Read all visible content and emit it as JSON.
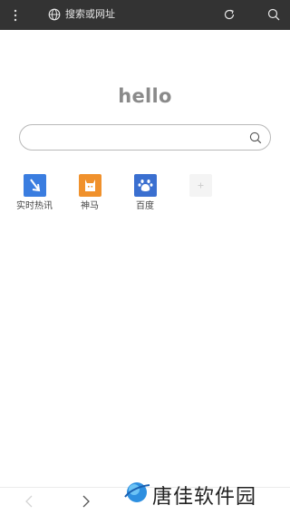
{
  "toolbar": {
    "url_placeholder": "搜索或网址",
    "icons": [
      "more-vertical-icon",
      "globe-icon",
      "refresh-icon",
      "search-icon"
    ]
  },
  "home": {
    "greeting": "hello",
    "search_value": "",
    "quick_links": [
      {
        "label": "实时热讯",
        "icon": "news-arrow-icon",
        "color": "#3a7de0"
      },
      {
        "label": "神马",
        "icon": "shenma-horse-icon",
        "color": "#f0912c"
      },
      {
        "label": "百度",
        "icon": "baidu-paw-icon",
        "color": "#3a6fd0"
      },
      {
        "label": "",
        "icon": "add-icon",
        "color": "#f4f4f4"
      }
    ]
  },
  "navigation": {
    "icons": [
      "back-icon",
      "forward-icon"
    ]
  },
  "watermark": {
    "text": "唐佳软件园"
  }
}
